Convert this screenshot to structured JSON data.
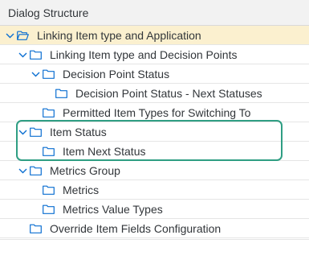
{
  "header": {
    "title": "Dialog Structure"
  },
  "tree": {
    "items": [
      {
        "label": "Linking Item type and Application",
        "level": 0,
        "expanded": true,
        "selected": true,
        "open_folder": true
      },
      {
        "label": "Linking Item type and Decision Points",
        "level": 1,
        "expanded": true
      },
      {
        "label": "Decision Point Status",
        "level": 2,
        "expanded": true
      },
      {
        "label": "Decision Point Status - Next Statuses",
        "level": 3
      },
      {
        "label": "Permitted Item Types for Switching To",
        "level": 2
      },
      {
        "label": "Item Status",
        "level": 1,
        "expanded": true
      },
      {
        "label": "Item Next Status",
        "level": 2
      },
      {
        "label": "Metrics Group",
        "level": 1,
        "expanded": true
      },
      {
        "label": "Metrics",
        "level": 2
      },
      {
        "label": "Metrics Value Types",
        "level": 2
      },
      {
        "label": "Override Item Fields Configuration",
        "level": 1
      }
    ]
  },
  "colors": {
    "selected_row": "#fbf0cf",
    "highlight_outline": "#2f9e83",
    "icon_blue": "#0a6ed1"
  }
}
